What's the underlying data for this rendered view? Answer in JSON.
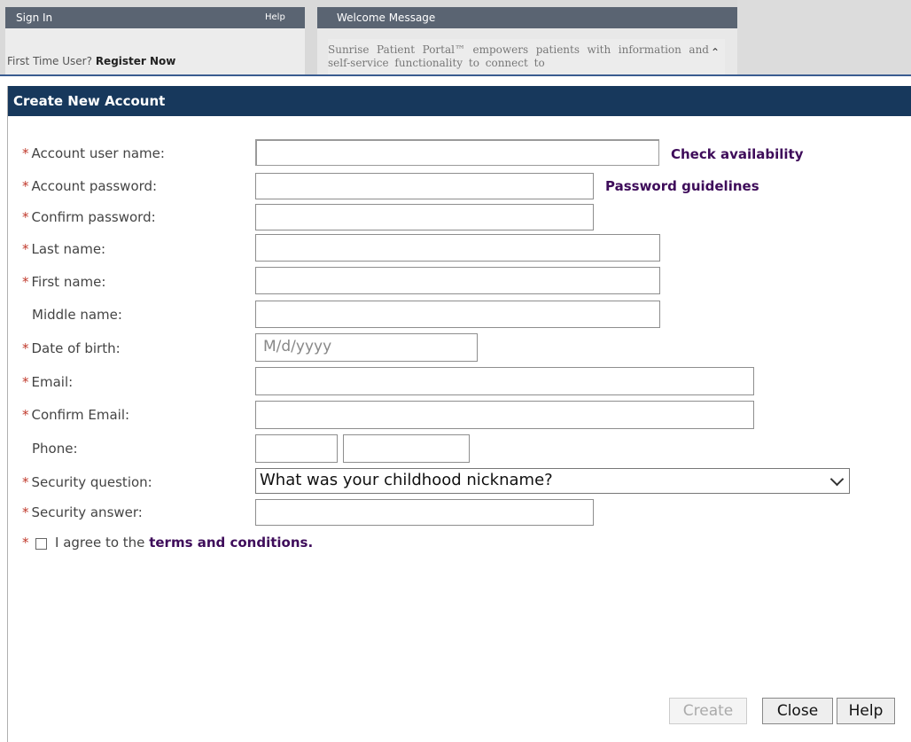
{
  "background": {
    "signin": {
      "title": "Sign In",
      "help": "Help",
      "first_time_text": "First Time User?",
      "register_link": "Register Now"
    },
    "welcome": {
      "title": "Welcome Message",
      "text": "Sunrise Patient Portal™ empowers patients with information and self-service functionality to connect to"
    }
  },
  "dialog": {
    "title": "Create New Account",
    "fields": {
      "username": {
        "label": "Account user name:",
        "required": true,
        "value": ""
      },
      "password": {
        "label": "Account password:",
        "required": true,
        "value": ""
      },
      "confirm_password": {
        "label": "Confirm password:",
        "required": true,
        "value": ""
      },
      "last_name": {
        "label": "Last name:",
        "required": true,
        "value": ""
      },
      "first_name": {
        "label": "First name:",
        "required": true,
        "value": ""
      },
      "middle_name": {
        "label": "Middle name:",
        "required": false,
        "value": ""
      },
      "dob": {
        "label": "Date of birth:",
        "required": true,
        "placeholder": "M/d/yyyy"
      },
      "email": {
        "label": "Email:",
        "required": true,
        "value": ""
      },
      "confirm_email": {
        "label": "Confirm Email:",
        "required": true,
        "value": ""
      },
      "phone": {
        "label": "Phone:",
        "required": false,
        "value": ""
      },
      "security_question": {
        "label": "Security question:",
        "required": true,
        "selected": "What was your childhood nickname?"
      },
      "security_answer": {
        "label": "Security answer:",
        "required": true,
        "value": ""
      }
    },
    "links": {
      "check_availability": "Check availability",
      "password_guidelines": "Password guidelines"
    },
    "agree": {
      "prefix": "I agree to the",
      "terms_link": "terms and conditions.",
      "checked": false
    },
    "buttons": {
      "create": "Create",
      "close": "Close",
      "help": "Help"
    },
    "required_marker": "*",
    "colors": {
      "title_bar": "#17385c",
      "link": "#3e0c5a",
      "required": "#c0392b"
    }
  }
}
